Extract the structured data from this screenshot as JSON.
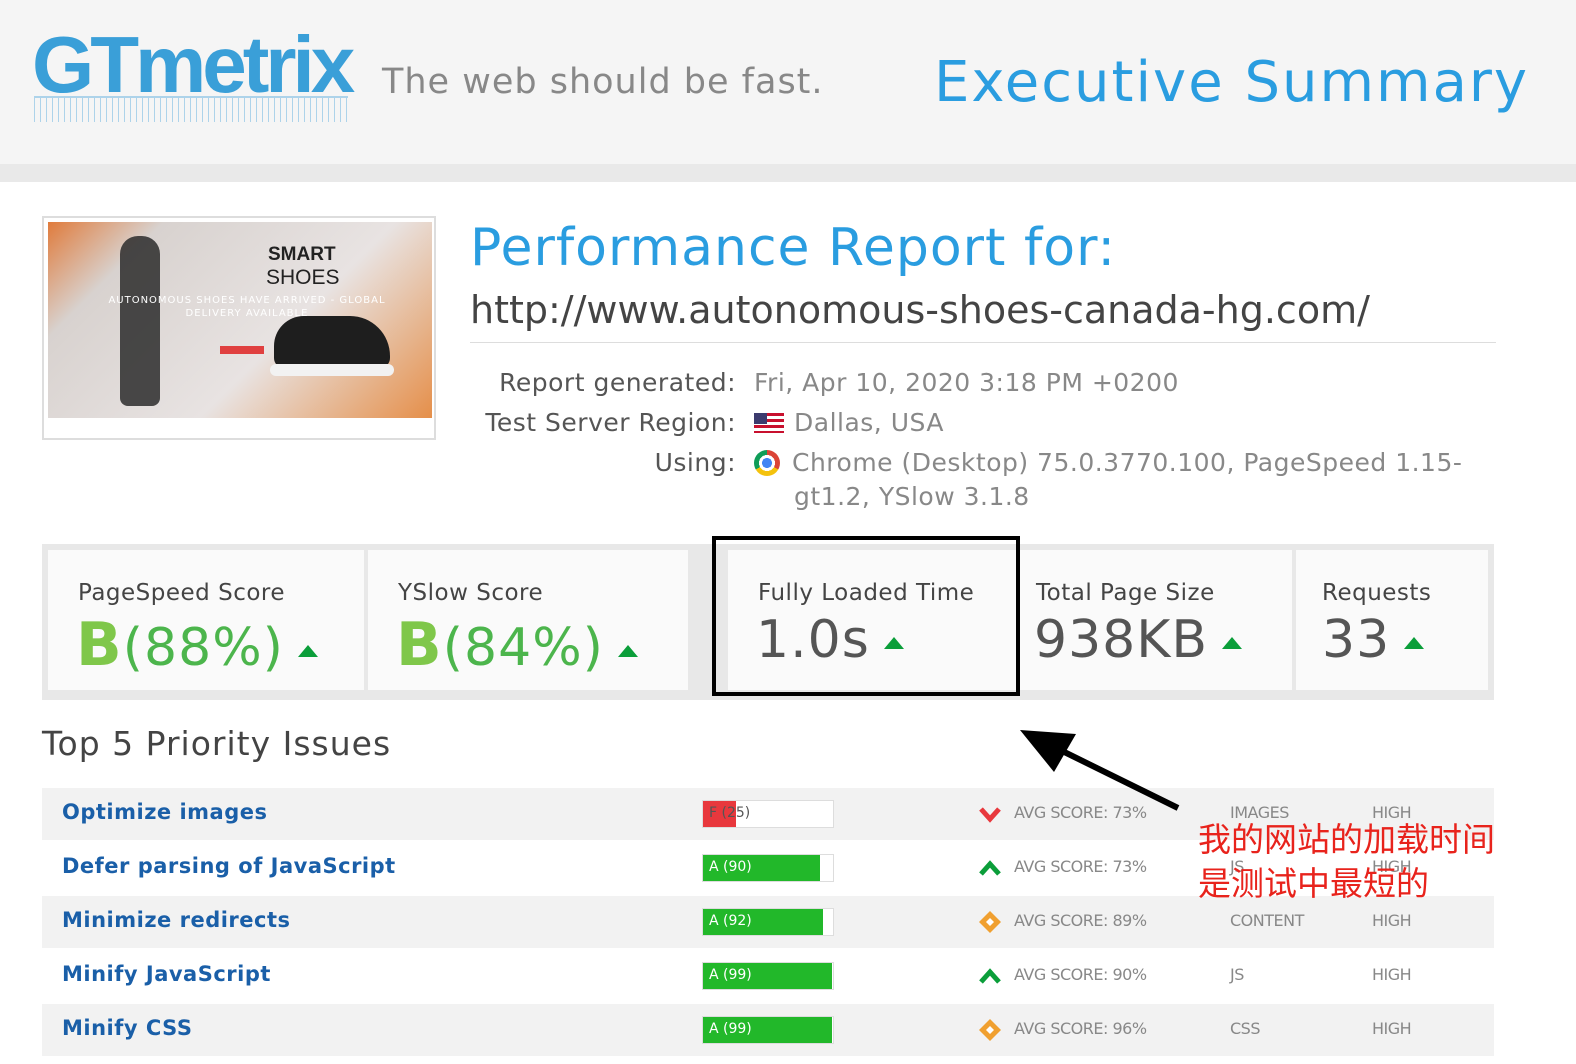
{
  "header": {
    "logo": "GTmetrix",
    "tagline": "The web should be fast.",
    "section_title": "Executive Summary"
  },
  "thumbnail": {
    "heading_1": "SMART",
    "heading_2": "SHOES",
    "subtext": "AUTONOMOUS SHOES HAVE ARRIVED - GLOBAL DELIVERY AVAILABLE"
  },
  "report": {
    "title": "Performance Report for:",
    "url": "http://www.autonomous-shoes-canada-hg.com/",
    "meta": [
      {
        "label": "Report generated:",
        "value": "Fri, Apr 10, 2020 3:18 PM +0200"
      },
      {
        "label": "Test Server Region:",
        "value": "Dallas, USA"
      },
      {
        "label": "Using:",
        "value": "Chrome (Desktop) 75.0.3770.100, PageSpeed 1.15-",
        "value_2": "gt1.2, YSlow 3.1.8"
      }
    ]
  },
  "scores": {
    "pagespeed": {
      "label": "PageSpeed Score",
      "grade": "B",
      "value": "(88%)"
    },
    "yslow": {
      "label": "YSlow Score",
      "grade": "B",
      "value": "(84%)"
    },
    "loaded": {
      "label": "Fully Loaded Time",
      "value": "1.0s"
    },
    "size": {
      "label": "Total Page Size",
      "value": "938KB"
    },
    "requests": {
      "label": "Requests",
      "value": "33"
    }
  },
  "issues_title": "Top 5 Priority Issues",
  "issues": [
    {
      "name": "Optimize images",
      "score_text": "F (25)",
      "score": 25,
      "avg": "AVG SCORE: 73%",
      "trend": "down",
      "category": "IMAGES",
      "priority": "HIGH"
    },
    {
      "name": "Defer parsing of JavaScript",
      "score_text": "A (90)",
      "score": 90,
      "avg": "AVG SCORE: 73%",
      "trend": "up",
      "category": "JS",
      "priority": "HIGH"
    },
    {
      "name": "Minimize redirects",
      "score_text": "A (92)",
      "score": 92,
      "avg": "AVG SCORE: 89%",
      "trend": "neutral",
      "category": "CONTENT",
      "priority": "HIGH"
    },
    {
      "name": "Minify JavaScript",
      "score_text": "A (99)",
      "score": 99,
      "avg": "AVG SCORE: 90%",
      "trend": "up",
      "category": "JS",
      "priority": "HIGH"
    },
    {
      "name": "Minify CSS",
      "score_text": "A (99)",
      "score": 99,
      "avg": "AVG SCORE: 96%",
      "trend": "neutral",
      "category": "CSS",
      "priority": "HIGH"
    }
  ],
  "annotation": {
    "line_1": "我的网站的加载时间",
    "line_2": "是测试中最短的"
  },
  "colors": {
    "brand_blue": "#2a9de0",
    "grade_green": "#7fc74a",
    "bar_green": "#22b82a",
    "bar_red": "#e8383d",
    "trend_up": "#0b9e3a",
    "trend_down": "#e8383d",
    "trend_neutral": "#f0a030",
    "annotation_red": "#e8231c"
  }
}
